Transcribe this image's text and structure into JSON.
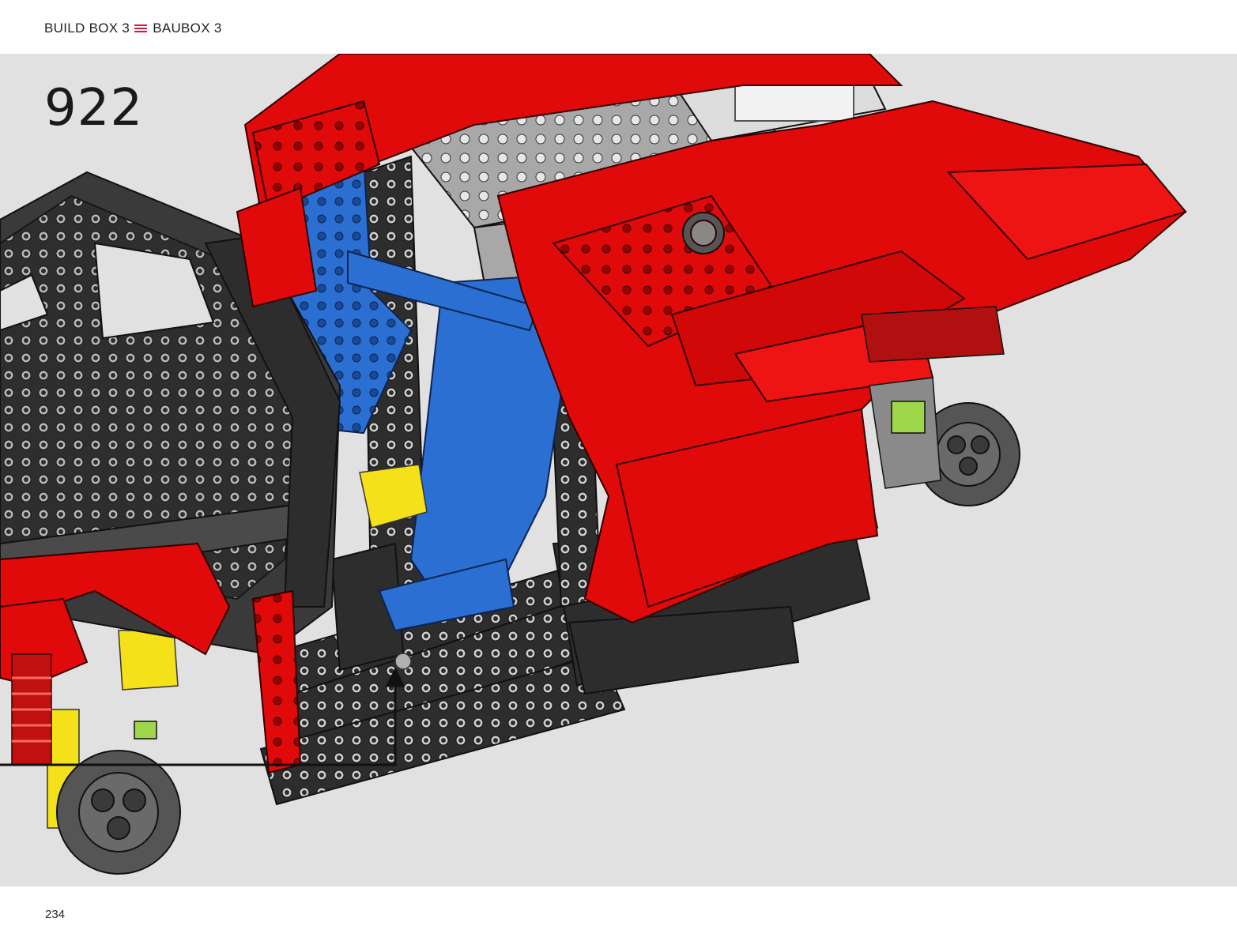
{
  "header": {
    "left_label": "BUILD BOX 3",
    "right_label": "BAUBOX 3",
    "divider_icon": "triple-bar-icon",
    "divider_color": "#d6163c"
  },
  "step": {
    "number": "922"
  },
  "illustration": {
    "subject": "lego-technic-car-chassis",
    "colors": {
      "body_red": "#e10a0a",
      "frame_black": "#2d2d2d",
      "seat_blue": "#2a6fd1",
      "grey": "#a8a8a8",
      "yellow": "#f5e11a",
      "lime": "#9ed64a",
      "background": "#e1e1e1"
    }
  },
  "footer": {
    "page_number": "234"
  }
}
